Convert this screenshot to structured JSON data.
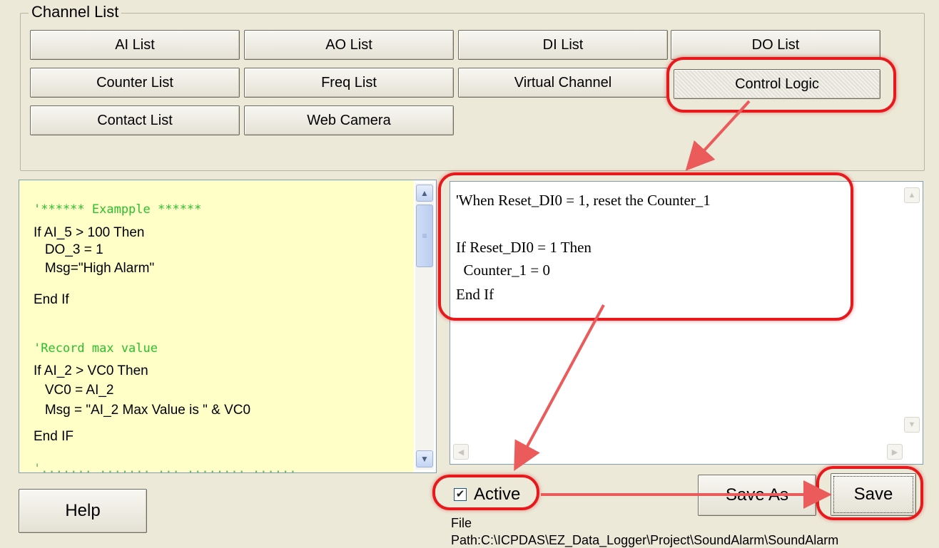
{
  "group": {
    "title": "Channel List"
  },
  "channel_buttons": [
    "AI List",
    "AO List",
    "DI List",
    "DO List",
    "Counter List",
    "Freq List",
    "Virtual Channel",
    "Control Logic",
    "Contact List",
    "Web Camera"
  ],
  "example_code": {
    "title_comment": "'****** Exampple ******",
    "block1": [
      "If AI_5 > 100 Then",
      "   DO_3 = 1",
      "   Msg=\"High Alarm\"",
      "End If"
    ],
    "comment2": "'Record max value",
    "block2": [
      "If AI_2 > VC0 Then",
      "   VC0 = AI_2",
      "   Msg = \"AI_2 Max Value is \" & VC0",
      "End IF"
    ]
  },
  "editor": {
    "lines": [
      "'When Reset_DI0 = 1, reset the Counter_1",
      "",
      "If Reset_DI0 = 1 Then",
      "  Counter_1 = 0",
      "End If"
    ]
  },
  "controls": {
    "active_label": "Active",
    "active_checked": true,
    "help_label": "Help",
    "save_as_label": "Save As",
    "save_label": "Save",
    "file_label": "File",
    "file_path": "Path:C:\\ICPDAS\\EZ_Data_Logger\\Project\\SoundAlarm\\SoundAlarm"
  },
  "colors": {
    "annotation": "#e8191d",
    "comment_green": "#2cbf2c",
    "example_bg": "#ffffc8"
  }
}
